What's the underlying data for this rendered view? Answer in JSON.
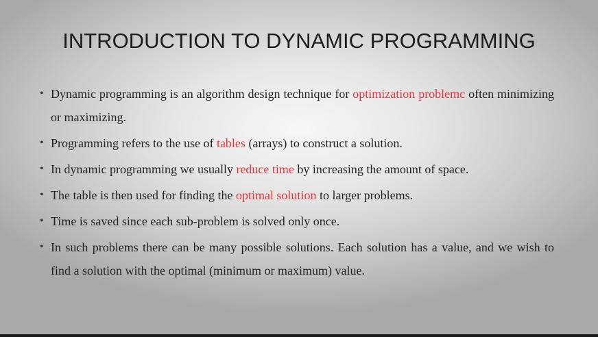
{
  "slide": {
    "title": "INTRODUCTION TO DYNAMIC PROGRAMMING",
    "bullet_glyph": "•",
    "highlight_color": "#e8343b",
    "bullets": [
      {
        "pre": "Dynamic programming is an algorithm design technique for ",
        "hl": "optimization problemc",
        "post": " often minimizing or maximizing."
      },
      {
        "pre": "Programming refers to the use of ",
        "hl": "tables",
        "post": " (arrays) to construct a solution."
      },
      {
        "pre": "In dynamic programming we usually ",
        "hl": "reduce time",
        "post": " by increasing the amount of space."
      },
      {
        "pre": "The table is then used for finding the ",
        "hl": "optimal solution",
        "post": " to larger problems."
      },
      {
        "pre": "Time is saved since each sub-problem is solved only once.",
        "hl": "",
        "post": ""
      },
      {
        "pre": "In such problems there can be many possible solutions. Each solution has a value, and we wish to find a solution with the optimal (minimum or maximum) value.",
        "hl": "",
        "post": ""
      }
    ]
  }
}
